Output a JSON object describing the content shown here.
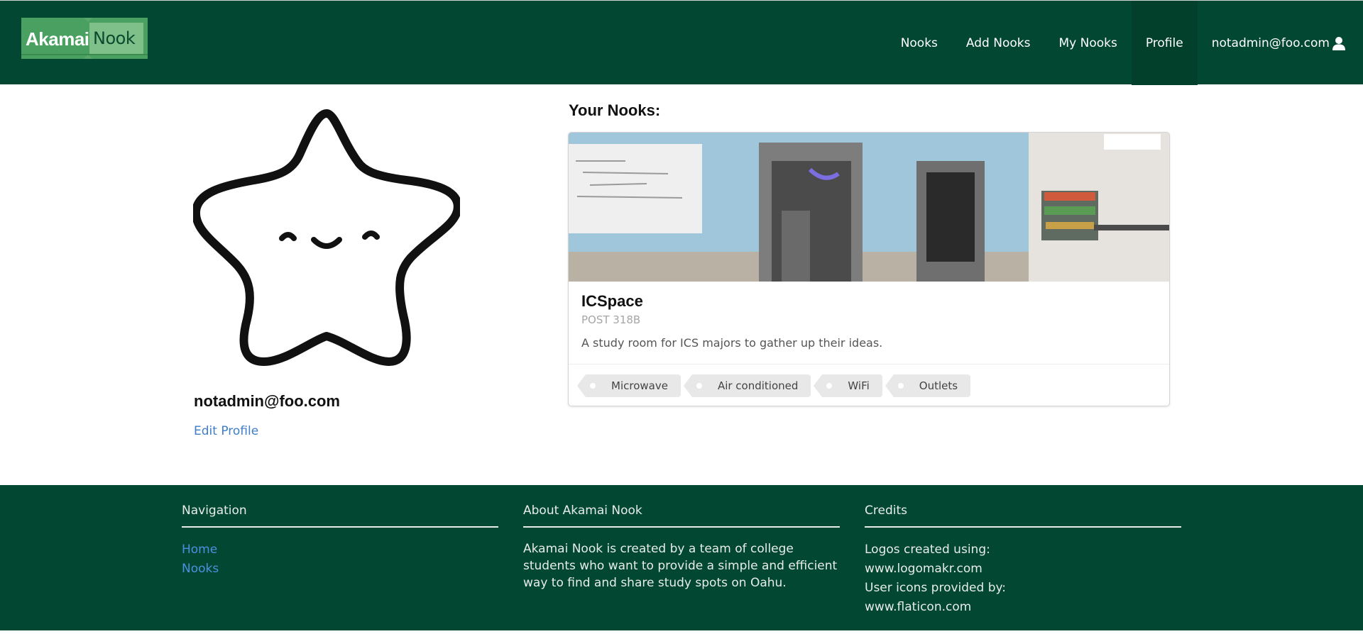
{
  "brand": {
    "word1": "Akamai",
    "word2": "Nook"
  },
  "nav": {
    "items": [
      {
        "label": "Nooks"
      },
      {
        "label": "Add Nooks"
      },
      {
        "label": "My Nooks"
      },
      {
        "label": "Profile",
        "active": true
      }
    ],
    "user": "notadmin@foo.com",
    "user_icon": "user-icon"
  },
  "profile": {
    "avatar_icon": "star-face-icon",
    "email": "notadmin@foo.com",
    "edit_label": "Edit Profile"
  },
  "nooks": {
    "heading": "Your Nooks:",
    "cards": [
      {
        "title": "ICSpace",
        "location": "POST 318B",
        "description": "A study room for ICS majors to gather up their ideas.",
        "tags": [
          "Microwave",
          "Air conditioned",
          "WiFi",
          "Outlets"
        ]
      }
    ]
  },
  "footer": {
    "navigation": {
      "heading": "Navigation",
      "links": [
        "Home",
        "Nooks"
      ]
    },
    "about": {
      "heading": "About Akamai Nook",
      "text": "Akamai Nook is created by a team of college students who want to provide a simple and efficient way to find and share study spots on Oahu."
    },
    "credits": {
      "heading": "Credits",
      "lines": [
        "Logos created using:",
        "www.logomakr.com",
        "User icons provided by:",
        "www.flaticon.com"
      ]
    }
  },
  "colors": {
    "header_bg": "#024731",
    "footer_bg": "#024731",
    "link": "#3f7ec9",
    "logo_green": "#4aa060"
  }
}
